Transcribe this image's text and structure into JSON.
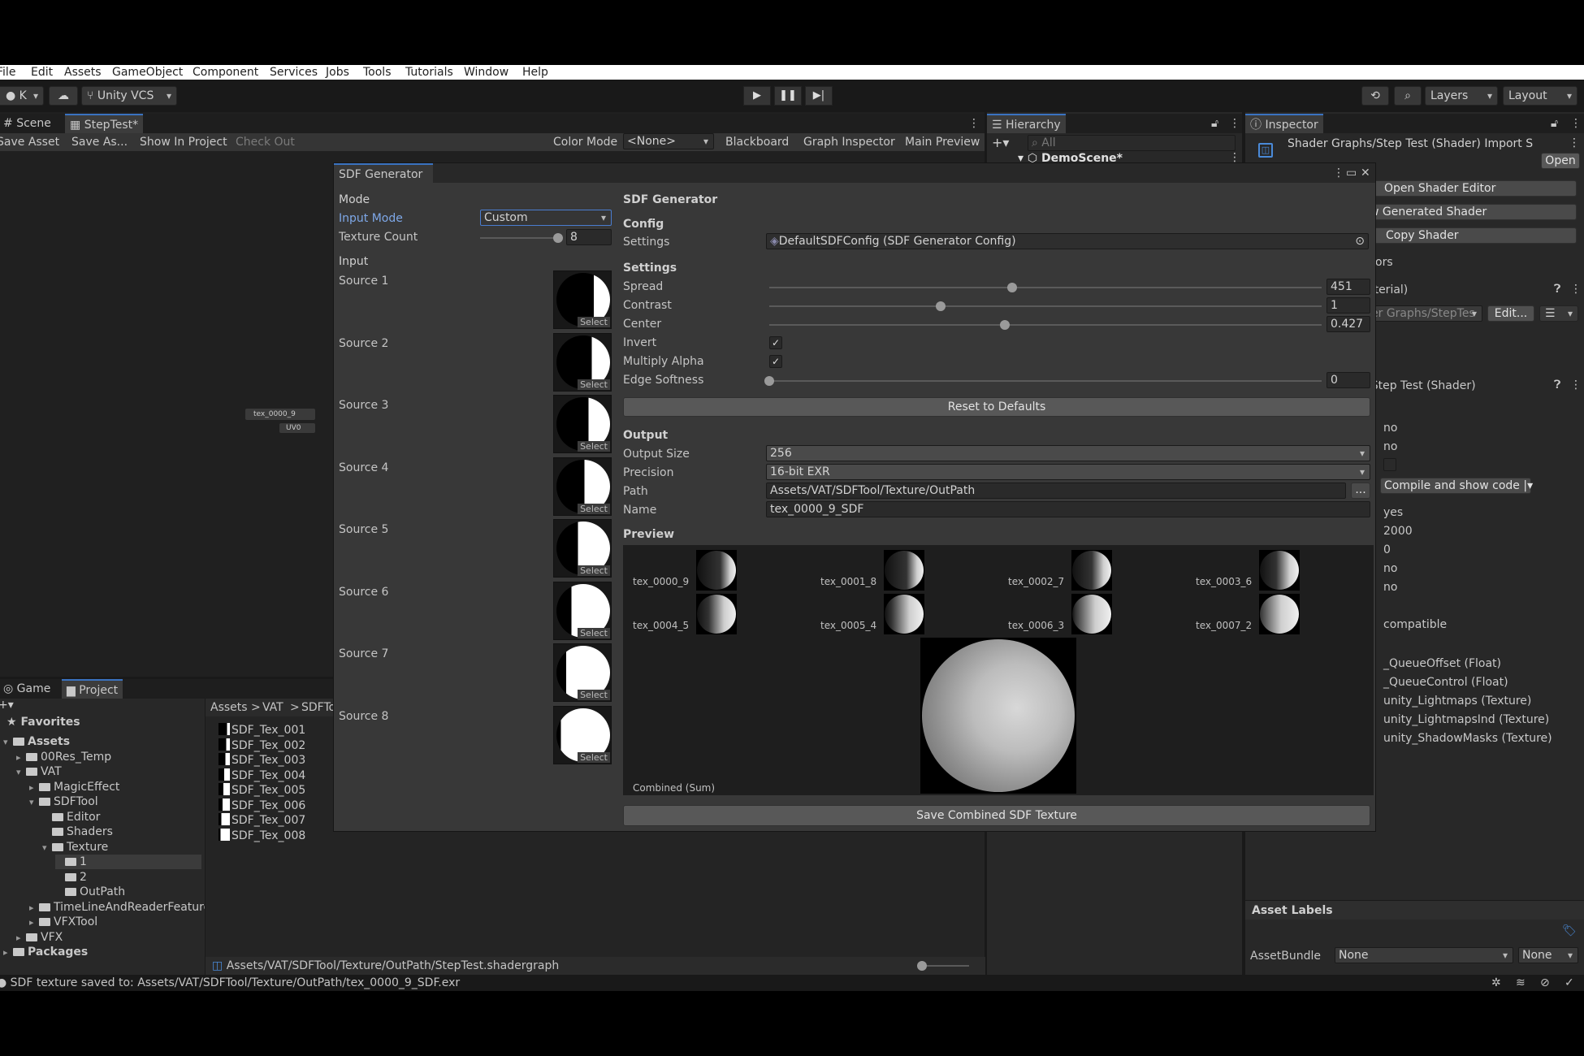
{
  "menu": [
    "File",
    "Edit",
    "Assets",
    "GameObject",
    "Component",
    "Services",
    "Jobs",
    "Tools",
    "Tutorials",
    "Window",
    "Help"
  ],
  "toolbar": {
    "account": "K",
    "vcs": "Unity VCS",
    "layers": "Layers",
    "layout": "Layout",
    "play": "▶",
    "pause": "❚❚",
    "step": "▶|"
  },
  "scene_tabs": {
    "scene": "Scene",
    "steptest": "StepTest*"
  },
  "graph_bar": {
    "save_asset": "Save Asset",
    "save_as": "Save As...",
    "show_in_project": "Show In Project",
    "check_out": "Check Out",
    "color_mode_label": "Color Mode",
    "color_mode_value": "<None>",
    "blackboard": "Blackboard",
    "graph_inspector": "Graph Inspector",
    "main_preview": "Main Preview"
  },
  "graph_nodes": {
    "tex_node": "tex_0000_9",
    "uv_node": "UV0"
  },
  "hierarchy": {
    "tab": "Hierarchy",
    "search_placeholder": "All",
    "scene": "DemoScene*"
  },
  "inspector": {
    "tab": "Inspector",
    "title": "Shader Graphs/Step Test (Shader) Import S",
    "open": "Open",
    "open_shader_editor": "Open Shader Editor",
    "view_generated": "w Generated Shader",
    "copy_shader": "Copy Shader",
    "errors": "ors",
    "material": "aterial)",
    "graph_path": "er Graphs/StepTes",
    "edit": "Edit...",
    "shader_header": "/Step Test (Shader)",
    "rows": [
      "no",
      "no"
    ],
    "compile": "Compile and show code",
    "values": [
      "yes",
      "2000",
      "0",
      "no",
      "no"
    ],
    "compatible": "compatible",
    "props": [
      "_QueueOffset (Float)",
      "_QueueControl (Float)",
      "unity_Lightmaps (Texture)",
      "unity_LightmapsInd (Texture)",
      "unity_ShadowMasks (Texture)"
    ],
    "asset_labels": "Asset Labels",
    "assetbundle_label": "AssetBundle",
    "assetbundle_value": "None",
    "assetbundle_variant": "None"
  },
  "project": {
    "tabs": {
      "game": "Game",
      "project": "Project"
    },
    "favorites": "Favorites",
    "tree": [
      {
        "label": "Assets",
        "indent": 0,
        "bold": true,
        "arrow": "▾"
      },
      {
        "label": "00Res_Temp",
        "indent": 1,
        "arrow": "▸"
      },
      {
        "label": "VAT",
        "indent": 1,
        "arrow": "▾"
      },
      {
        "label": "MagicEffect",
        "indent": 2,
        "arrow": "▸"
      },
      {
        "label": "SDFTool",
        "indent": 2,
        "arrow": "▾"
      },
      {
        "label": "Editor",
        "indent": 3,
        "arrow": ""
      },
      {
        "label": "Shaders",
        "indent": 3,
        "arrow": ""
      },
      {
        "label": "Texture",
        "indent": 3,
        "arrow": "▾"
      },
      {
        "label": "1",
        "indent": 4,
        "arrow": "",
        "selected": true
      },
      {
        "label": "2",
        "indent": 4,
        "arrow": ""
      },
      {
        "label": "OutPath",
        "indent": 4,
        "arrow": ""
      },
      {
        "label": "TimeLineAndReaderFeature",
        "indent": 2,
        "arrow": "▸"
      },
      {
        "label": "VFXTool",
        "indent": 2,
        "arrow": "▸"
      },
      {
        "label": "VFX",
        "indent": 1,
        "arrow": "▸"
      },
      {
        "label": "Packages",
        "indent": 0,
        "bold": true,
        "arrow": "▸"
      }
    ],
    "breadcrumb": [
      "Assets",
      ">",
      "VAT",
      ">",
      "SDFTo"
    ],
    "files": [
      "SDF_Tex_001",
      "SDF_Tex_002",
      "SDF_Tex_003",
      "SDF_Tex_004",
      "SDF_Tex_005",
      "SDF_Tex_006",
      "SDF_Tex_007",
      "SDF_Tex_008"
    ],
    "footer_path": "Assets/VAT/SDFTool/Texture/OutPath/StepTest.shadergraph"
  },
  "status": "SDF texture saved to: Assets/VAT/SDFTool/Texture/OutPath/tex_0000_9_SDF.exr",
  "sdf": {
    "tab": "SDF Generator",
    "mode_header": "Mode",
    "input_mode_label": "Input Mode",
    "input_mode_value": "Custom",
    "texture_count_label": "Texture Count",
    "texture_count_value": "8",
    "texture_count_fraction": 1.0,
    "input_header": "Input",
    "sources": [
      "Source 1",
      "Source 2",
      "Source 3",
      "Source 4",
      "Source 5",
      "Source 6",
      "Source 7",
      "Source 8"
    ],
    "select": "Select",
    "title": "SDF Generator",
    "config_header": "Config",
    "settings_label": "Settings",
    "settings_value": "DefaultSDFConfig (SDF Generator Config)",
    "settings_header": "Settings",
    "spread_label": "Spread",
    "spread_value": "451",
    "spread_fraction": 0.44,
    "contrast_label": "Contrast",
    "contrast_value": "1",
    "contrast_fraction": 0.31,
    "center_label": "Center",
    "center_value": "0.427",
    "center_fraction": 0.427,
    "invert_label": "Invert",
    "invert_checked": "✓",
    "multiply_label": "Multiply Alpha",
    "multiply_checked": "✓",
    "edge_label": "Edge Softness",
    "edge_value": "0",
    "edge_fraction": 0,
    "reset": "Reset to Defaults",
    "output_header": "Output",
    "output_size_label": "Output Size",
    "output_size_value": "256",
    "precision_label": "Precision",
    "precision_value": "16-bit EXR",
    "path_label": "Path",
    "path_value": "Assets/VAT/SDFTool/Texture/OutPath",
    "path_btn": "...",
    "name_label": "Name",
    "name_value": "tex_0000_9_SDF",
    "preview_header": "Preview",
    "previews": [
      "tex_0000_9",
      "tex_0001_8",
      "tex_0002_7",
      "tex_0003_6",
      "tex_0004_5",
      "tex_0005_4",
      "tex_0006_3",
      "tex_0007_2"
    ],
    "combined_label": "Combined (Sum)",
    "save": "Save Combined SDF Texture"
  }
}
